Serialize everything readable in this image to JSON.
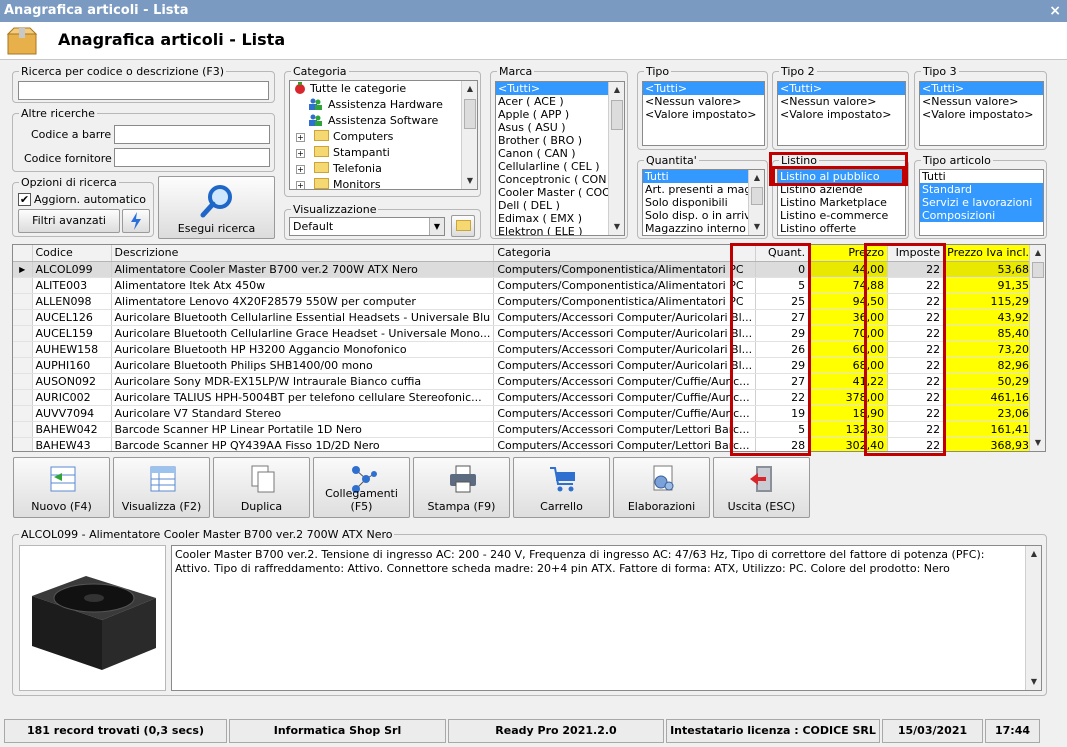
{
  "window": {
    "title": "Anagrafica articoli  - Lista",
    "close_glyph": "×"
  },
  "header": {
    "title": "Anagrafica articoli  - Lista",
    "icon": "box-icon"
  },
  "search": {
    "legend": "Ricerca per codice o descrizione (F3)",
    "value": ""
  },
  "other": {
    "legend": "Altre ricerche",
    "barcode_label": "Codice a barre :",
    "supplier_label": "Codice fornitore :"
  },
  "options": {
    "legend": "Opzioni di ricerca",
    "auto_label": "Aggiorn. automatico",
    "advanced_label": "Filtri avanzati"
  },
  "execute": {
    "label": "Esegui ricerca"
  },
  "categoria": {
    "legend": "Categoria",
    "items": [
      "Tutte le categorie",
      "Assistenza Hardware",
      "Assistenza Software",
      "Computers",
      "Stampanti",
      "Telefonia",
      "Monitors"
    ]
  },
  "visual": {
    "legend": "Visualizzazione",
    "value": "Default"
  },
  "marca": {
    "legend": "Marca",
    "items": [
      "<Tutti>",
      "Acer ( ACE )",
      "Apple ( APP )",
      "Asus ( ASU )",
      "Brother ( BRO )",
      "Canon ( CAN )",
      "Cellularline ( CEL )",
      "Conceptronic ( CON )",
      "Cooler Master ( COO )",
      "Dell ( DEL )",
      "Edimax ( EMX )",
      "Elektron ( ELE )"
    ]
  },
  "tipo": {
    "legend": "Tipo",
    "items": [
      "<Tutti>",
      "<Nessun valore>",
      "<Valore impostato>"
    ]
  },
  "tipo2": {
    "legend": "Tipo 2",
    "items": [
      "<Tutti>",
      "<Nessun valore>",
      "<Valore impostato>"
    ]
  },
  "tipo3": {
    "legend": "Tipo 3",
    "items": [
      "<Tutti>",
      "<Nessun valore>",
      "<Valore impostato>"
    ]
  },
  "quantita": {
    "legend": "Quantita'",
    "items": [
      "Tutti",
      "Art. presenti a magazzino",
      "Solo disponibili",
      "Solo disp. o in arrivo",
      "Magazzino interno"
    ]
  },
  "listino": {
    "legend": "Listino",
    "items": [
      "Listino al pubblico",
      "Listino aziende",
      "Listino Marketplace",
      "Listino e-commerce",
      "Listino offerte"
    ]
  },
  "tipoart": {
    "legend": "Tipo articolo",
    "items": [
      "Tutti",
      "Standard",
      "Servizi e lavorazioni",
      "Composizioni"
    ]
  },
  "grid": {
    "columns": [
      "Codice",
      "Descrizione",
      "Categoria",
      "Quant.",
      "Prezzo",
      "Imposte",
      "Prezzo Iva incl."
    ],
    "current_marker": "▶",
    "rows": [
      [
        "ALCOL099",
        "Alimentatore Cooler Master B700 ver.2 700W ATX Nero",
        "Computers/Componentistica/Alimentatori PC",
        "0",
        "44,00",
        "22",
        "53,68"
      ],
      [
        "ALITE003",
        "Alimentatore Itek Atx 450w",
        "Computers/Componentistica/Alimentatori PC",
        "5",
        "74,88",
        "22",
        "91,35"
      ],
      [
        "ALLEN098",
        "Alimentatore Lenovo 4X20F28579 550W per computer",
        "Computers/Componentistica/Alimentatori PC",
        "25",
        "94,50",
        "22",
        "115,29"
      ],
      [
        "AUCEL126",
        "Auricolare Bluetooth Cellularline Essential Headsets - Universale Blu",
        "Computers/Accessori Computer/Auricolari Bl...",
        "27",
        "36,00",
        "22",
        "43,92"
      ],
      [
        "AUCEL159",
        "Auricolare Bluetooth Cellularline Grace Headset - Universale Mono...",
        "Computers/Accessori Computer/Auricolari Bl...",
        "29",
        "70,00",
        "22",
        "85,40"
      ],
      [
        "AUHEW158",
        "Auricolare Bluetooth HP H3200 Aggancio Monofonico",
        "Computers/Accessori Computer/Auricolari Bl...",
        "26",
        "60,00",
        "22",
        "73,20"
      ],
      [
        "AUPHI160",
        "Auricolare Bluetooth Philips SHB1400/00 mono",
        "Computers/Accessori Computer/Auricolari Bl...",
        "29",
        "68,00",
        "22",
        "82,96"
      ],
      [
        "AUSON092",
        "Auricolare Sony MDR-EX15LP/W Intraurale Bianco cuffia",
        "Computers/Accessori Computer/Cuffie/Auric...",
        "27",
        "41,22",
        "22",
        "50,29"
      ],
      [
        "AURIC002",
        "Auricolare TALIUS HPH-5004BT per telefono cellulare Stereofonic...",
        "Computers/Accessori Computer/Cuffie/Auric...",
        "22",
        "378,00",
        "22",
        "461,16"
      ],
      [
        "AUVV7094",
        "Auricolare V7 Standard Stereo",
        "Computers/Accessori Computer/Cuffie/Auric...",
        "19",
        "18,90",
        "22",
        "23,06"
      ],
      [
        "BAHEW042",
        "Barcode Scanner HP Linear Portatile 1D Nero",
        "Computers/Accessori Computer/Lettori Barc...",
        "5",
        "132,30",
        "22",
        "161,41"
      ],
      [
        "BAHEW43",
        "Barcode Scanner HP QY439AA Fisso 1D/2D Nero",
        "Computers/Accessori Computer/Lettori Barc...",
        "28",
        "302,40",
        "22",
        "368,93"
      ]
    ]
  },
  "toolbar": [
    {
      "label": "Nuovo (F4)",
      "icon": "new-icon"
    },
    {
      "label": "Visualizza (F2)",
      "icon": "view-icon"
    },
    {
      "label": "Duplica",
      "icon": "duplicate-icon"
    },
    {
      "label": "Collegamenti (F5)",
      "icon": "links-icon"
    },
    {
      "label": "Stampa (F9)",
      "icon": "printer-icon"
    },
    {
      "label": "Carrello",
      "icon": "cart-icon"
    },
    {
      "label": "Elaborazioni",
      "icon": "processing-icon"
    },
    {
      "label": "Uscita (ESC)",
      "icon": "exit-icon"
    }
  ],
  "detail": {
    "legend": "ALCOL099 - Alimentatore Cooler Master B700 ver.2 700W ATX Nero",
    "text": "Cooler Master B700 ver.2. Tensione di ingresso AC: 200 - 240 V, Frequenza di ingresso AC: 47/63 Hz, Tipo di correttore del fattore di potenza (PFC): Attivo. Tipo di raffreddamento: Attivo. Connettore scheda madre: 20+4 pin ATX. Fattore di forma: ATX, Utilizzo: PC. Colore del prodotto: Nero"
  },
  "status": {
    "records": "181 record trovati (0,3 secs)",
    "company": "Informatica Shop Srl",
    "version": "Ready Pro 2021.2.0",
    "license": "Intestatario licenza : CODICE SRL",
    "date": "15/03/2021",
    "time": "17:44"
  },
  "colors": {
    "selection": "#3399ff",
    "highlight": "#ffff00",
    "annotation": "#c00000",
    "titlebar": "#7a9ac2"
  }
}
